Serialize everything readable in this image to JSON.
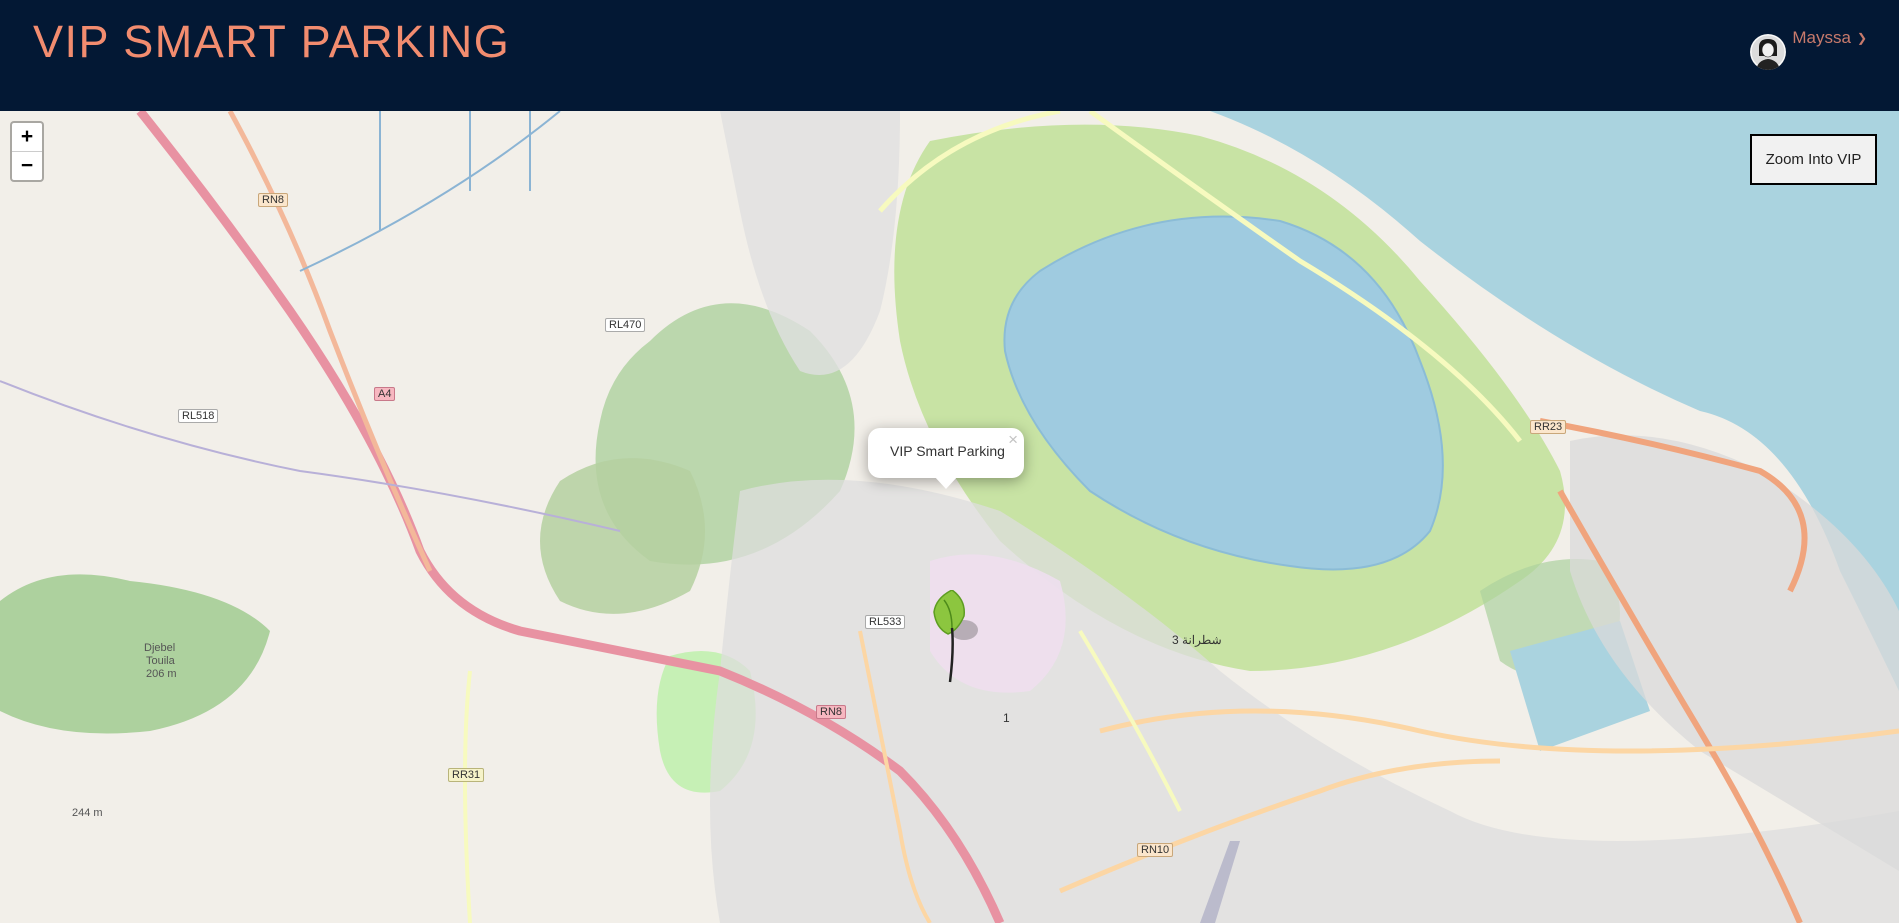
{
  "header": {
    "brand": "VIP SMART PARKING",
    "user_name": "Mayssa",
    "chevron_icon": "chevron-down-icon",
    "avatar_icon": "user-avatar-icon"
  },
  "map": {
    "zoom_in_label": "+",
    "zoom_out_label": "−",
    "zoom_into_vip_label": "Zoom Into VIP",
    "popup": {
      "text": "VIP Smart Parking",
      "close_label": "×"
    },
    "marker_icon": "map-pin-icon",
    "road_labels": [
      "RN8",
      "RL470",
      "RL518",
      "A4",
      "RL533",
      "RN8",
      "RR31",
      "RN10",
      "RR23"
    ],
    "place_labels": [
      "Djebel",
      "Touila",
      "206 m",
      "244 m",
      "3 شطرانة",
      "1"
    ],
    "colors": {
      "navbar": "#031834",
      "brand": "#f28c6f",
      "water": "#aad3df",
      "park": "#add19e",
      "wetland": "#c8e3a4",
      "motorway": "#e892a2",
      "primary_road": "#fcd6a4"
    }
  }
}
